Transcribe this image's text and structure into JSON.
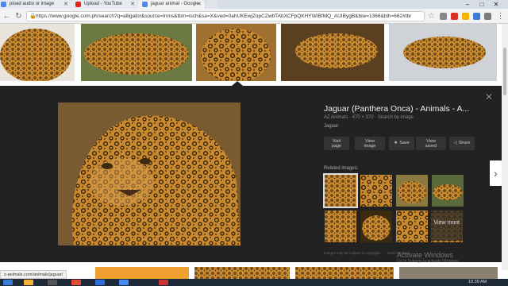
{
  "browser": {
    "tabs": [
      {
        "label": "pload audio or image",
        "icon_color": "#4a8af4"
      },
      {
        "label": "Upload - YouTube",
        "icon_color": "#e62117"
      },
      {
        "label": "jaguar animal - Google",
        "icon_color": "#4a8af4"
      }
    ],
    "url": "https://www.google.com.ph/search?q=alligator&source=lnms&tbm=isch&sa=X&ved=0ahUKEwjZopCZwbTAbXCFpQKHYWIBfMQ_AUIBygB&biw=1366&bih=662#tbr",
    "window_buttons": [
      "–",
      "□",
      "✕"
    ],
    "ext_colors": [
      "#888888",
      "#d93025",
      "#f4b400",
      "#3c7ad8",
      "#7a7a7a"
    ]
  },
  "thumbnails": {
    "colors": [
      "#b08040",
      "#8a6a30",
      "#c98a3a",
      "#7a5a28",
      "#9a9a8a"
    ]
  },
  "detail": {
    "title": "Jaguar (Panthera Onca) - Animals - A...",
    "meta": "AZ Animals · 470 × 370 · Search by image",
    "source_tag": "Jaguar",
    "actions": [
      {
        "label1": "Visit",
        "label2": "page",
        "icon": ""
      },
      {
        "label1": "View",
        "label2": "image",
        "icon": ""
      },
      {
        "label1": "Save",
        "label2": "",
        "icon": "★"
      },
      {
        "label1": "View",
        "label2": "saved",
        "icon": ""
      },
      {
        "label1": "Share",
        "label2": "",
        "icon": "◁"
      }
    ],
    "related_label": "Related images:",
    "view_more": "View more",
    "copyright": "Images may be subject to copyright.",
    "feedback": "Send feedback",
    "watermark_title": "Activate Windows",
    "watermark_sub": "Go to Settings to activate Windows.",
    "next_arrow": "›",
    "close": "✕"
  },
  "status_url": "z-animals.com/animals/jaguar/",
  "taskbar": {
    "clock": "10:39 AM",
    "apps": [
      "#3a7bd5",
      "#f2b233",
      "#555555",
      "#e24a3a",
      "#2d6cdf",
      "#4a8af4",
      "#cc3333"
    ]
  }
}
